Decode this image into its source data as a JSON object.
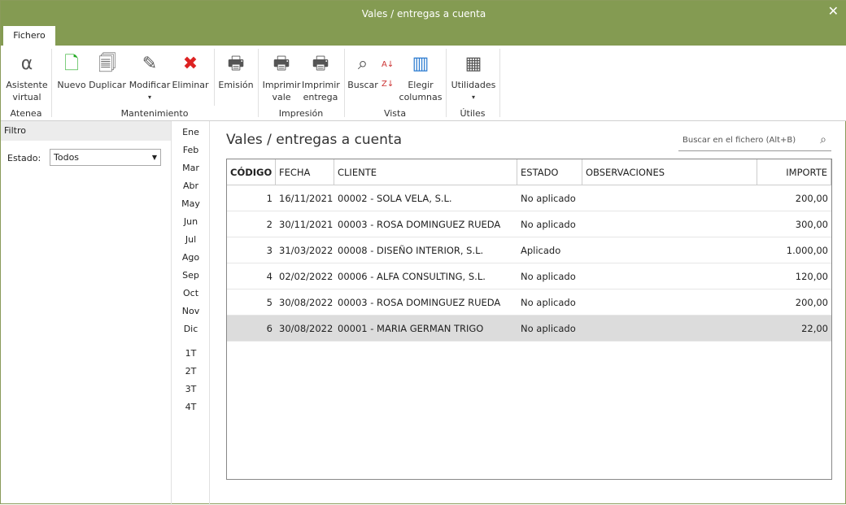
{
  "window": {
    "title": "Vales / entregas a cuenta",
    "close": "✕"
  },
  "tabs": [
    "Fichero"
  ],
  "ribbon": {
    "buttons": [
      {
        "label1": "Asistente",
        "label2": "virtual",
        "icon": "alpha-icon",
        "glyph": "α"
      },
      {
        "label1": "Nuevo",
        "label2": "",
        "icon": "new-document-icon",
        "glyph": "🗋"
      },
      {
        "label1": "Duplicar",
        "label2": "",
        "icon": "duplicate-icon",
        "glyph": "🗐"
      },
      {
        "label1": "Modificar",
        "label2": "▾",
        "icon": "edit-document-icon",
        "glyph": "✎"
      },
      {
        "label1": "Eliminar",
        "label2": "",
        "icon": "delete-document-icon",
        "glyph": "✖"
      },
      {
        "label1": "Emisión",
        "label2": "",
        "icon": "emission-icon",
        "glyph": "🖶"
      },
      {
        "label1": "Imprimir",
        "label2": "vale",
        "icon": "printer-icon",
        "glyph": "🖶"
      },
      {
        "label1": "Imprimir",
        "label2": "entrega",
        "icon": "printer-icon",
        "glyph": "🖶"
      },
      {
        "label1": "Buscar",
        "label2": "",
        "icon": "binoculars-icon",
        "glyph": "⌕"
      },
      {
        "label1": "Elegir",
        "label2": "columnas",
        "icon": "columns-icon",
        "glyph": "▥"
      },
      {
        "label1": "Utilidades",
        "label2": "▾",
        "icon": "calculator-icon",
        "glyph": "▦"
      }
    ],
    "groups": [
      "Atenea",
      "Mantenimiento",
      "Impresión",
      "Vista",
      "Útiles"
    ]
  },
  "filter": {
    "title": "Filtro",
    "estado_label": "Estado:",
    "estado_value": "Todos"
  },
  "months": [
    "Ene",
    "Feb",
    "Mar",
    "Abr",
    "May",
    "Jun",
    "Jul",
    "Ago",
    "Sep",
    "Oct",
    "Nov",
    "Dic"
  ],
  "quarters": [
    "1T",
    "2T",
    "3T",
    "4T"
  ],
  "main": {
    "title": "Vales / entregas a cuenta",
    "search_placeholder": "Buscar en el fichero (Alt+B)"
  },
  "table": {
    "headers": [
      "CÓDIGO",
      "FECHA",
      "CLIENTE",
      "ESTADO",
      "OBSERVACIONES",
      "IMPORTE"
    ],
    "rows": [
      [
        "1",
        "16/11/2021",
        "00002 - SOLA VELA, S.L.",
        "No aplicado",
        "",
        "200,00"
      ],
      [
        "2",
        "30/11/2021",
        "00003 - ROSA DOMINGUEZ RUEDA",
        "No aplicado",
        "",
        "300,00"
      ],
      [
        "3",
        "31/03/2022",
        "00008 - DISEÑO INTERIOR, S.L.",
        "Aplicado",
        "",
        "1.000,00"
      ],
      [
        "4",
        "02/02/2022",
        "00006 - ALFA CONSULTING, S.L.",
        "No aplicado",
        "",
        "120,00"
      ],
      [
        "5",
        "30/08/2022",
        "00003 - ROSA DOMINGUEZ RUEDA",
        "No aplicado",
        "",
        "200,00"
      ],
      [
        "6",
        "30/08/2022",
        "00001 - MARIA GERMAN TRIGO",
        "No aplicado",
        "",
        "22,00"
      ]
    ],
    "selected_row": 6
  }
}
